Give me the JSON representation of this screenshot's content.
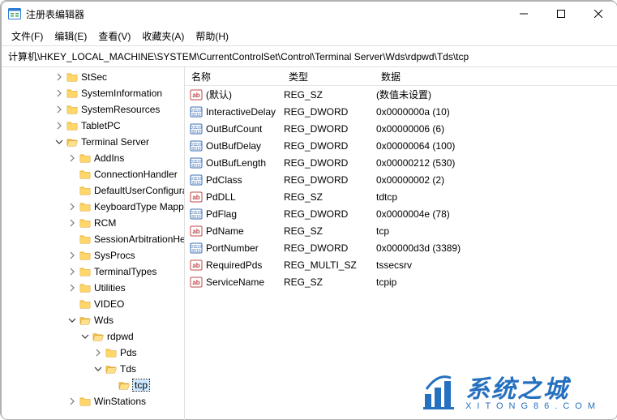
{
  "window": {
    "title": "注册表编辑器"
  },
  "menus": {
    "file": "文件(F)",
    "edit": "编辑(E)",
    "view": "查看(V)",
    "fav": "收藏夹(A)",
    "help": "帮助(H)"
  },
  "path": "计算机\\HKEY_LOCAL_MACHINE\\SYSTEM\\CurrentControlSet\\Control\\Terminal Server\\Wds\\rdpwd\\Tds\\tcp",
  "tree": [
    {
      "indent": 4,
      "toggle": ">",
      "label": "StSec"
    },
    {
      "indent": 4,
      "toggle": ">",
      "label": "SystemInformation"
    },
    {
      "indent": 4,
      "toggle": ">",
      "label": "SystemResources"
    },
    {
      "indent": 4,
      "toggle": ">",
      "label": "TabletPC"
    },
    {
      "indent": 4,
      "toggle": "v",
      "label": "Terminal Server"
    },
    {
      "indent": 5,
      "toggle": ">",
      "label": "AddIns"
    },
    {
      "indent": 5,
      "toggle": "",
      "label": "ConnectionHandler"
    },
    {
      "indent": 5,
      "toggle": "",
      "label": "DefaultUserConfiguration"
    },
    {
      "indent": 5,
      "toggle": ">",
      "label": "KeyboardType Mapping"
    },
    {
      "indent": 5,
      "toggle": ">",
      "label": "RCM"
    },
    {
      "indent": 5,
      "toggle": "",
      "label": "SessionArbitrationHelper"
    },
    {
      "indent": 5,
      "toggle": ">",
      "label": "SysProcs"
    },
    {
      "indent": 5,
      "toggle": ">",
      "label": "TerminalTypes"
    },
    {
      "indent": 5,
      "toggle": ">",
      "label": "Utilities"
    },
    {
      "indent": 5,
      "toggle": "",
      "label": "VIDEO"
    },
    {
      "indent": 5,
      "toggle": "v",
      "label": "Wds"
    },
    {
      "indent": 6,
      "toggle": "v",
      "label": "rdpwd"
    },
    {
      "indent": 7,
      "toggle": ">",
      "label": "Pds"
    },
    {
      "indent": 7,
      "toggle": "v",
      "label": "Tds"
    },
    {
      "indent": 8,
      "toggle": "",
      "label": "tcp",
      "selected": true
    },
    {
      "indent": 5,
      "toggle": ">",
      "label": "WinStations"
    }
  ],
  "columns": {
    "name": "名称",
    "type": "类型",
    "data": "数据"
  },
  "values": [
    {
      "icon": "str",
      "name": "(默认)",
      "type": "REG_SZ",
      "data": "(数值未设置)"
    },
    {
      "icon": "bin",
      "name": "InteractiveDelay",
      "type": "REG_DWORD",
      "data": "0x0000000a (10)"
    },
    {
      "icon": "bin",
      "name": "OutBufCount",
      "type": "REG_DWORD",
      "data": "0x00000006 (6)"
    },
    {
      "icon": "bin",
      "name": "OutBufDelay",
      "type": "REG_DWORD",
      "data": "0x00000064 (100)"
    },
    {
      "icon": "bin",
      "name": "OutBufLength",
      "type": "REG_DWORD",
      "data": "0x00000212 (530)"
    },
    {
      "icon": "bin",
      "name": "PdClass",
      "type": "REG_DWORD",
      "data": "0x00000002 (2)"
    },
    {
      "icon": "str",
      "name": "PdDLL",
      "type": "REG_SZ",
      "data": "tdtcp"
    },
    {
      "icon": "bin",
      "name": "PdFlag",
      "type": "REG_DWORD",
      "data": "0x0000004e (78)"
    },
    {
      "icon": "str",
      "name": "PdName",
      "type": "REG_SZ",
      "data": "tcp"
    },
    {
      "icon": "bin",
      "name": "PortNumber",
      "type": "REG_DWORD",
      "data": "0x00000d3d (3389)"
    },
    {
      "icon": "str",
      "name": "RequiredPds",
      "type": "REG_MULTI_SZ",
      "data": "tssecsrv"
    },
    {
      "icon": "str",
      "name": "ServiceName",
      "type": "REG_SZ",
      "data": "tcpip"
    }
  ],
  "watermark": {
    "main": "系统之城",
    "sub": "XITONG86.COM"
  }
}
